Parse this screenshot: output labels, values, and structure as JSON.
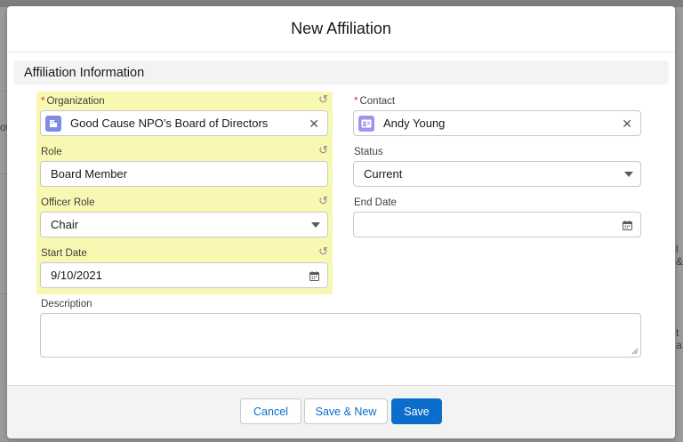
{
  "modal": {
    "title": "New Affiliation",
    "section_title": "Affiliation Information"
  },
  "background_fragments": [
    "ot",
    "l &",
    "t a"
  ],
  "fields": {
    "organization": {
      "label": "Organization",
      "required_mark": "*",
      "value": "Good Cause NPO’s Board of Directors",
      "icon": "account-icon",
      "icon_color": "#7f8de1",
      "highlighted": true
    },
    "contact": {
      "label": "Contact",
      "required_mark": "*",
      "value": "Andy Young",
      "icon": "contact-icon",
      "icon_color": "#a094ed"
    },
    "role": {
      "label": "Role",
      "value": "Board Member",
      "highlighted": true
    },
    "status": {
      "label": "Status",
      "value": "Current"
    },
    "officer_role": {
      "label": "Officer Role",
      "value": "Chair",
      "highlighted": true
    },
    "end_date": {
      "label": "End Date",
      "value": ""
    },
    "start_date": {
      "label": "Start Date",
      "value": "9/10/2021",
      "highlighted": true
    },
    "description": {
      "label": "Description",
      "value": ""
    }
  },
  "footer": {
    "cancel_label": "Cancel",
    "save_new_label": "Save & New",
    "save_label": "Save"
  },
  "colors": {
    "highlight": "#f9f8b3",
    "brand": "#0b6ecd",
    "required": "#c23934"
  }
}
